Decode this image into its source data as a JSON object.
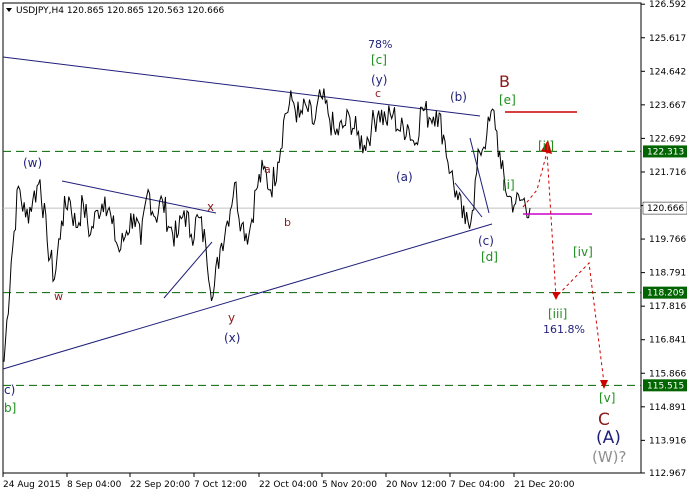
{
  "symbol_header": "USDJPY,H4  120.865 120.865 120.563 120.666",
  "chart_data": {
    "type": "line",
    "title": "",
    "xlabel": "",
    "ylabel": "",
    "ylim": [
      112.967,
      126.627
    ],
    "y_ticks": [
      126.592,
      125.617,
      124.642,
      123.667,
      122.692,
      121.716,
      120.741,
      119.766,
      118.791,
      117.816,
      116.841,
      115.866,
      114.891,
      113.916,
      112.967
    ],
    "x_ticks": [
      "24 Aug 2015",
      "8 Sep 04:00",
      "22 Sep 20:00",
      "7 Oct 12:00",
      "22 Oct 04:00",
      "5 Nov 20:00",
      "20 Nov 12:00",
      "7 Dec 04:00",
      "21 Dec 20:00"
    ],
    "price_series": {
      "x": [
        0,
        1,
        2,
        3,
        4,
        5,
        6,
        7,
        8,
        9,
        10,
        11,
        12,
        13,
        14,
        15,
        16,
        17,
        18,
        19,
        20,
        21,
        22,
        23,
        24,
        25,
        26,
        27,
        28,
        29,
        30,
        31,
        32,
        33,
        34,
        35,
        36,
        37,
        38,
        39,
        40,
        41,
        42,
        43,
        44,
        45,
        46,
        47,
        48,
        49,
        50,
        51,
        52,
        53,
        54,
        55,
        56,
        57,
        58,
        59,
        60,
        61,
        62,
        63,
        64,
        65,
        66,
        67,
        68,
        69,
        70,
        71,
        72,
        73,
        74,
        75,
        76,
        77,
        78,
        79,
        80,
        81,
        82,
        83,
        84,
        85,
        86,
        87,
        88,
        89,
        90
      ],
      "y": [
        116.2,
        119.1,
        121.3,
        120.4,
        120.9,
        121.5,
        119.7,
        118.6,
        120.3,
        121.0,
        120.1,
        120.8,
        119.9,
        120.6,
        121.0,
        120.2,
        119.4,
        120.0,
        120.5,
        119.6,
        121.2,
        120.4,
        120.9,
        120.1,
        119.8,
        120.6,
        119.9,
        120.4,
        119.6,
        118.1,
        119.5,
        120.3,
        121.4,
        120.2,
        119.9,
        121.2,
        121.8,
        121.2,
        122.0,
        123.4,
        123.8,
        123.3,
        123.6,
        123.1,
        123.9,
        123.4,
        122.8,
        123.0,
        123.3,
        122.8,
        122.5,
        123.0,
        123.5,
        123.2,
        123.4,
        122.9,
        123.1,
        122.5,
        123.6,
        123.3,
        123.5,
        122.8,
        121.7,
        120.9,
        120.2,
        120.6,
        122.3,
        122.8,
        123.5,
        121.8,
        121.0,
        120.8,
        120.9,
        120.666
      ],
      "name": ""
    },
    "ref_lines": [
      122.313,
      118.209,
      115.515
    ],
    "price_marker": 120.666,
    "forecast_path": [
      [
        523,
        207
      ],
      [
        537,
        190
      ],
      [
        547,
        152
      ],
      [
        556,
        297
      ],
      [
        589,
        263
      ],
      [
        604,
        383
      ]
    ],
    "wave_labels": [
      {
        "text": "78%"
      },
      {
        "text": "[c]"
      },
      {
        "text": "(y)"
      },
      {
        "text": "c"
      },
      {
        "text": "(b)"
      },
      {
        "text": "B"
      },
      {
        "text": "[e]"
      },
      {
        "text": "[ii]"
      },
      {
        "text": "(w)"
      },
      {
        "text": "a"
      },
      {
        "text": "x"
      },
      {
        "text": "(a)"
      },
      {
        "text": "[i]"
      },
      {
        "text": "b"
      },
      {
        "text": "(c)"
      },
      {
        "text": "[d]"
      },
      {
        "text": "[iv]"
      },
      {
        "text": "w"
      },
      {
        "text": "y"
      },
      {
        "text": "(x)"
      },
      {
        "text": "[iii]"
      },
      {
        "text": "161.8%"
      },
      {
        "text": "c)"
      },
      {
        "text": "b]"
      },
      {
        "text": "[v]"
      },
      {
        "text": "C"
      },
      {
        "text": "(A)"
      },
      {
        "text": "(W)?"
      }
    ]
  }
}
